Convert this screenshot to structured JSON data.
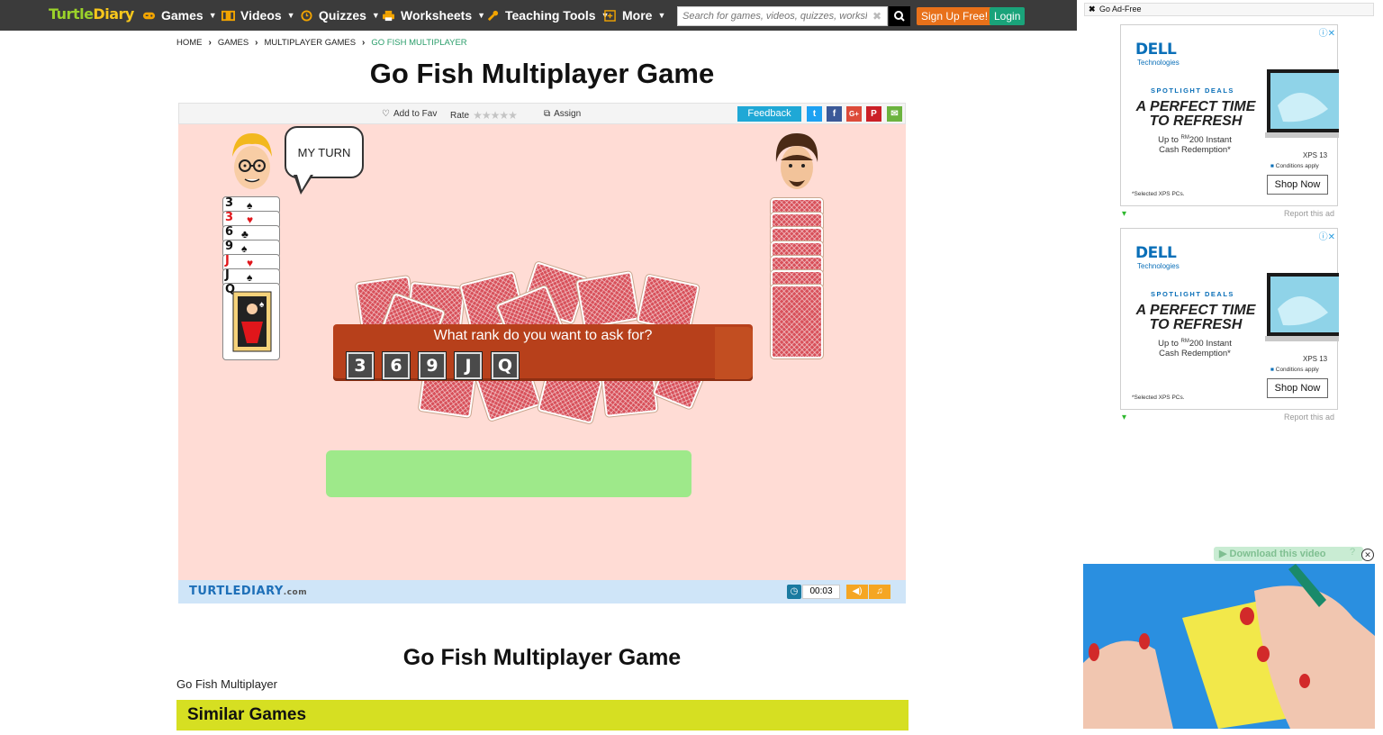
{
  "nav": {
    "logo_a": "Turtle",
    "logo_b": "Diary",
    "items": [
      {
        "label": "Games",
        "icon": "gamepad-icon"
      },
      {
        "label": "Videos",
        "icon": "film-icon"
      },
      {
        "label": "Quizzes",
        "icon": "clock-icon"
      },
      {
        "label": "Worksheets",
        "icon": "printer-icon"
      },
      {
        "label": "Teaching Tools",
        "icon": "wrench-icon"
      },
      {
        "label": "More",
        "icon": "plus-square-icon"
      }
    ],
    "search_placeholder": "Search for games, videos, quizzes, worksheets",
    "signup": "Sign Up Free!",
    "login": "Login"
  },
  "breadcrumb": [
    "HOME",
    "GAMES",
    "MULTIPLAYER GAMES",
    "GO FISH MULTIPLAYER"
  ],
  "page_title": "Go Fish Multiplayer Game",
  "toolbar": {
    "fav": "Add to Fav",
    "rate": "Rate",
    "stars": "★★★★★",
    "assign": "Assign",
    "feedback": "Feedback",
    "social": [
      {
        "name": "twitter",
        "glyph": "t",
        "color": "#1da1f2"
      },
      {
        "name": "facebook",
        "glyph": "f",
        "color": "#3b5998"
      },
      {
        "name": "google-plus",
        "glyph": "G+",
        "color": "#dd4b39"
      },
      {
        "name": "pinterest",
        "glyph": "P",
        "color": "#cb2027"
      },
      {
        "name": "email",
        "glyph": "✉",
        "color": "#6cb33f"
      }
    ]
  },
  "game": {
    "bubble": "MY TURN",
    "hand": [
      {
        "rank": "3",
        "suit": "♠",
        "color": "#111"
      },
      {
        "rank": "3",
        "suit": "♥",
        "color": "#e0161b"
      },
      {
        "rank": "6",
        "suit": "♣",
        "color": "#111"
      },
      {
        "rank": "9",
        "suit": "♠",
        "color": "#111"
      },
      {
        "rank": "J",
        "suit": "♥",
        "color": "#e0161b"
      },
      {
        "rank": "J",
        "suit": "♠",
        "color": "#111"
      },
      {
        "rank": "Q",
        "suit": "♠",
        "color": "#111"
      }
    ],
    "opponent_cards": 7,
    "prompt": "What rank do you want to ask for?",
    "ranks": [
      "3",
      "6",
      "9",
      "J",
      "Q"
    ],
    "timer": "00:03",
    "footer_logo": "TURTLEDIARY",
    "footer_logo_suffix": ".com"
  },
  "section_title": "Go Fish Multiplayer Game",
  "section_subtitle": "Go Fish Multiplayer",
  "similar_heading": "Similar Games",
  "ads": {
    "adfree": "Go Ad-Free",
    "brand": "DELL",
    "brand_sub": "Technologies",
    "spotlight": "SPOTLIGHT DEALS",
    "headline_1": "A PERFECT TIME",
    "headline_2": "TO REFRESH",
    "offer_prefix": "Up to ",
    "offer_currency": "RM",
    "offer_amount": "200 Instant",
    "offer_line2": "Cash Redemption*",
    "model": "XPS 13",
    "conditions": "Conditions apply",
    "cta": "Shop Now",
    "fine_print": "*Selected XPS PCs.",
    "report": "Report this ad"
  },
  "video": {
    "download": "Download this video",
    "help": "?"
  }
}
